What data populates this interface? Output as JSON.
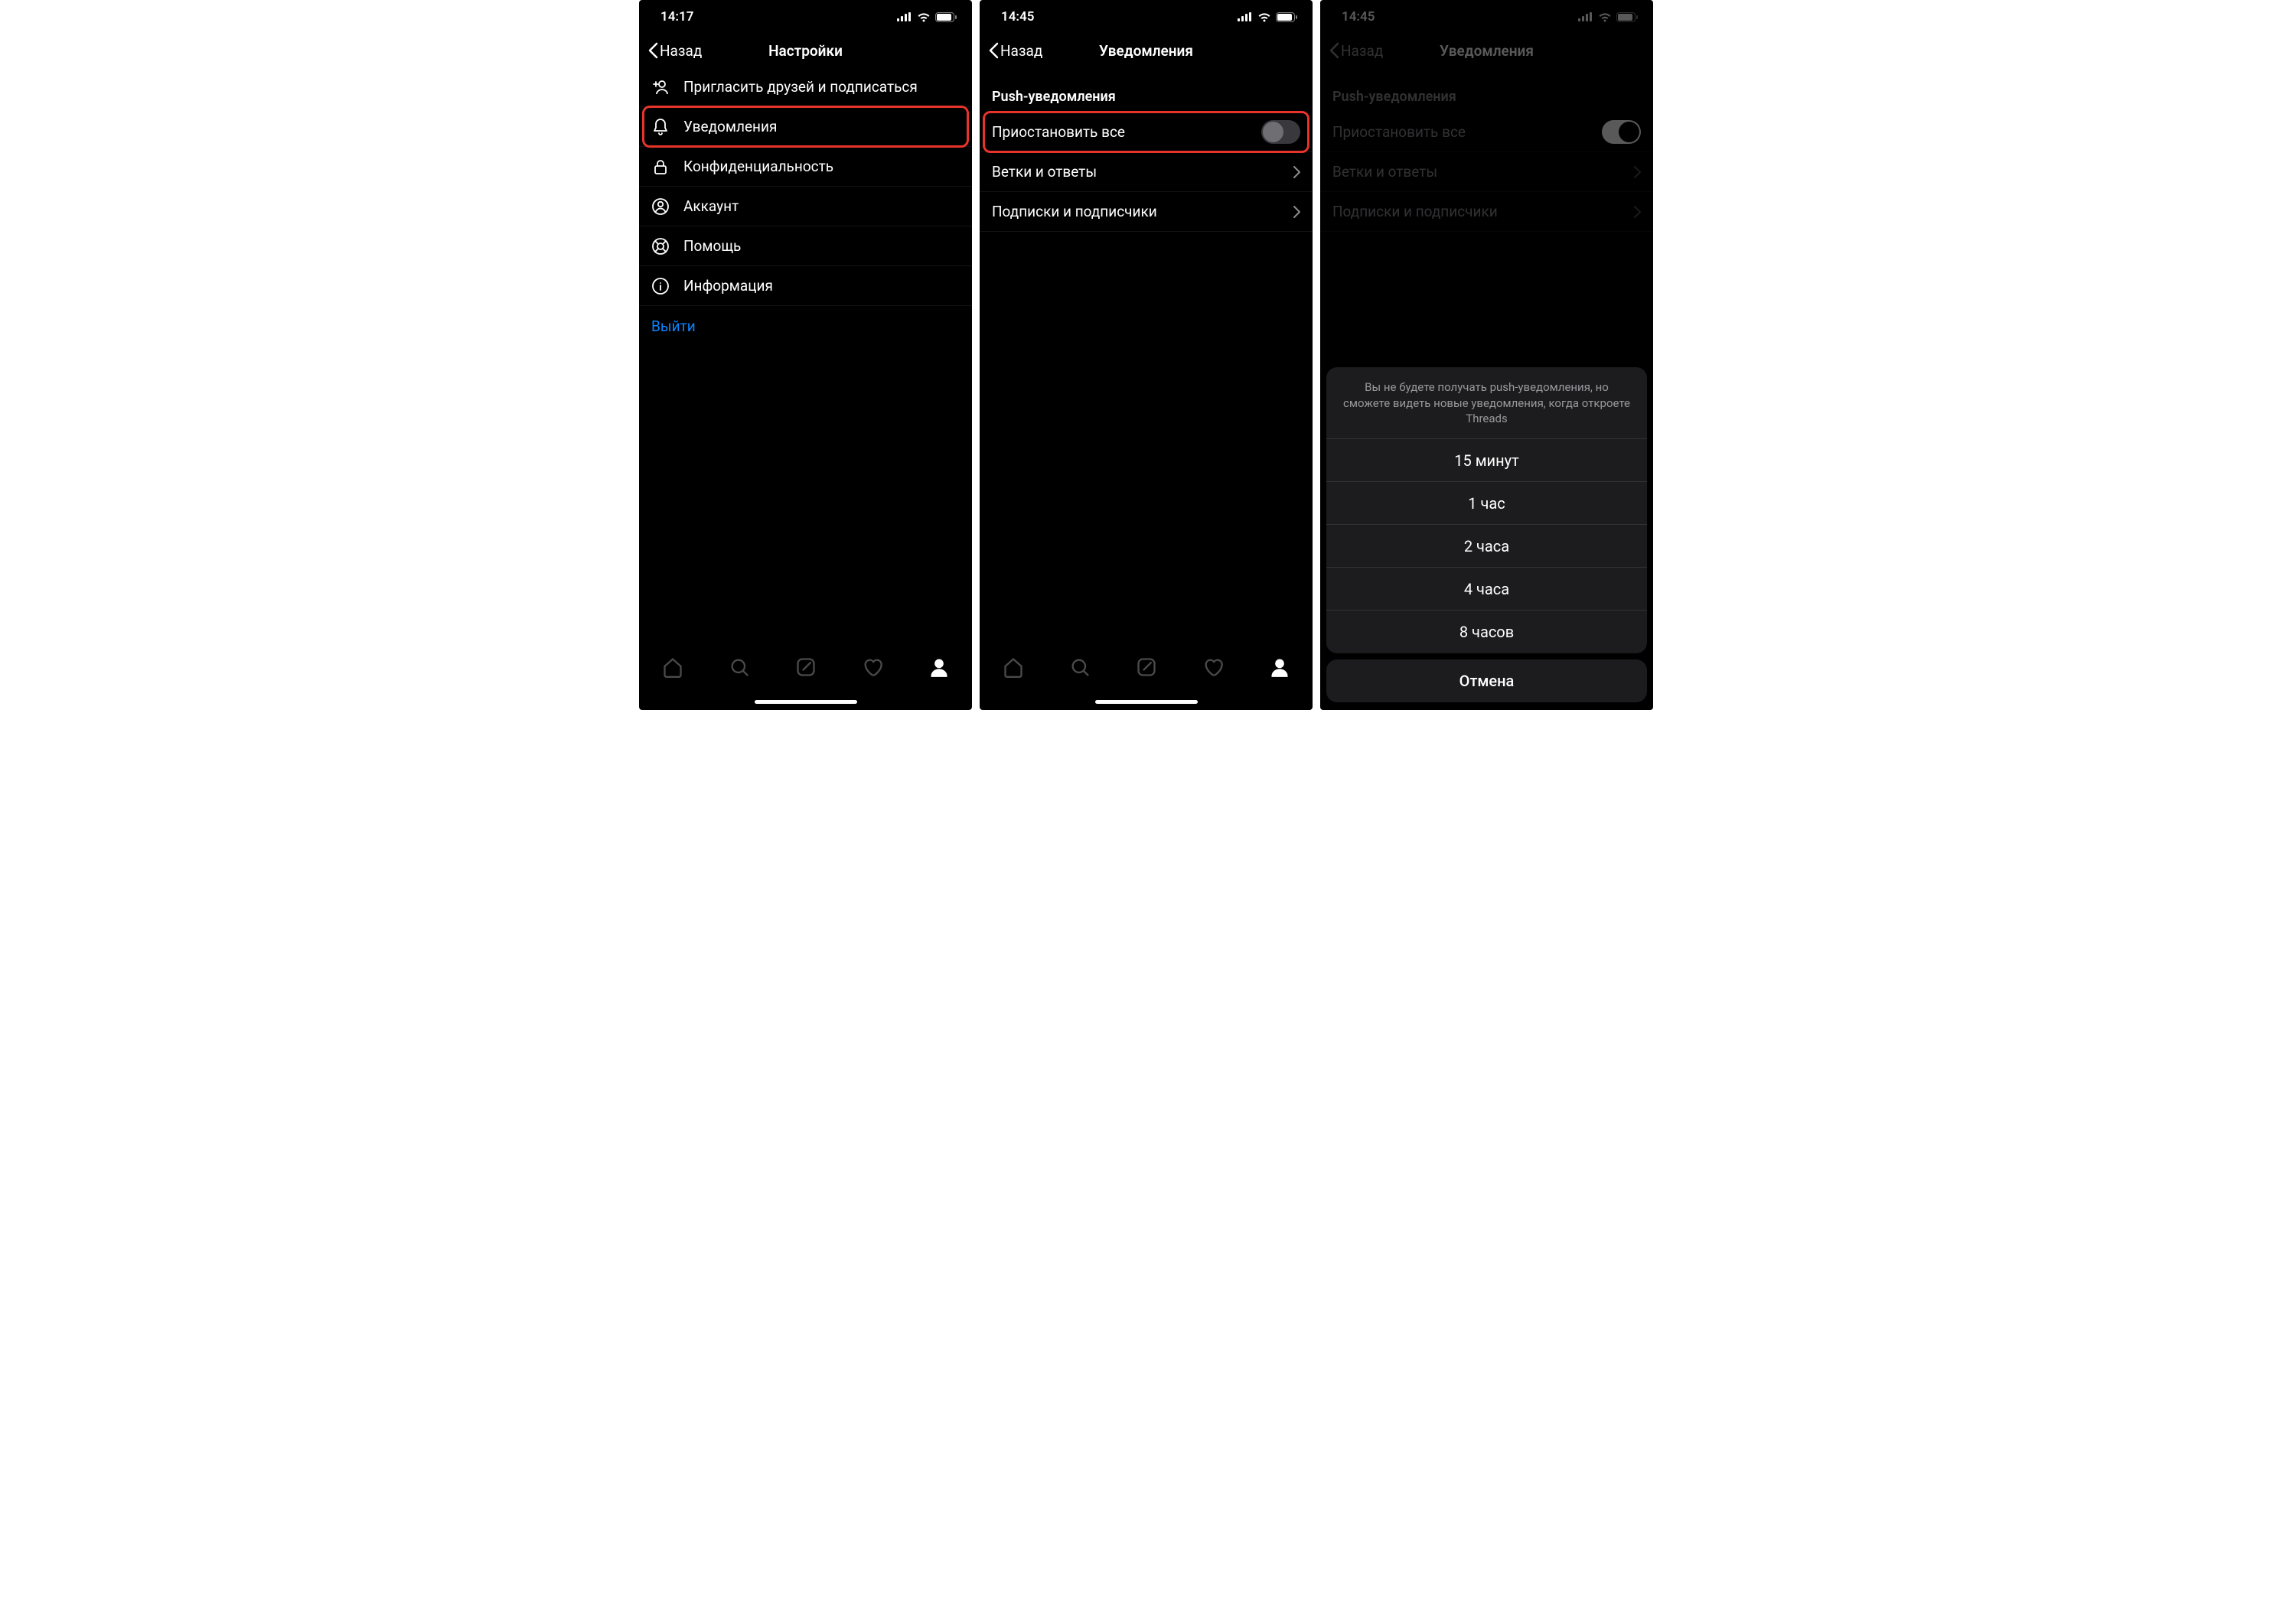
{
  "screens": {
    "a": {
      "status_time": "14:17",
      "nav_back": "Назад",
      "nav_title": "Настройки",
      "items": [
        {
          "icon": "add-person",
          "label": "Пригласить друзей и подписаться"
        },
        {
          "icon": "bell",
          "label": "Уведомления",
          "highlight": true
        },
        {
          "icon": "lock",
          "label": "Конфиденциальность"
        },
        {
          "icon": "account",
          "label": "Аккаунт"
        },
        {
          "icon": "lifebuoy",
          "label": "Помощь"
        },
        {
          "icon": "info",
          "label": "Информация"
        }
      ],
      "logout": "Выйти"
    },
    "b": {
      "status_time": "14:45",
      "nav_back": "Назад",
      "nav_title": "Уведомления",
      "section_header": "Push-уведомления",
      "rows": {
        "pause_all": {
          "label": "Приостановить все",
          "toggle_on": false,
          "highlight": true
        },
        "threads": {
          "label": "Ветки и ответы"
        },
        "follows": {
          "label": "Подписки и подписчики"
        }
      }
    },
    "c": {
      "status_time": "14:45",
      "nav_back": "Назад",
      "nav_title": "Уведомления",
      "section_header": "Push-уведомления",
      "rows": {
        "pause_all": {
          "label": "Приостановить все",
          "toggle_on": true
        },
        "threads": {
          "label": "Ветки и ответы"
        },
        "follows": {
          "label": "Подписки и подписчики"
        }
      },
      "sheet": {
        "description": "Вы не будете получать push-уведомления, но сможете видеть новые уведомления, когда откроете Threads",
        "options": [
          "15 минут",
          "1 час",
          "2 часа",
          "4 часа",
          "8 часов"
        ],
        "cancel": "Отмена"
      }
    }
  },
  "colors": {
    "highlight_border": "#e6342b",
    "link_blue": "#0a84ff"
  }
}
